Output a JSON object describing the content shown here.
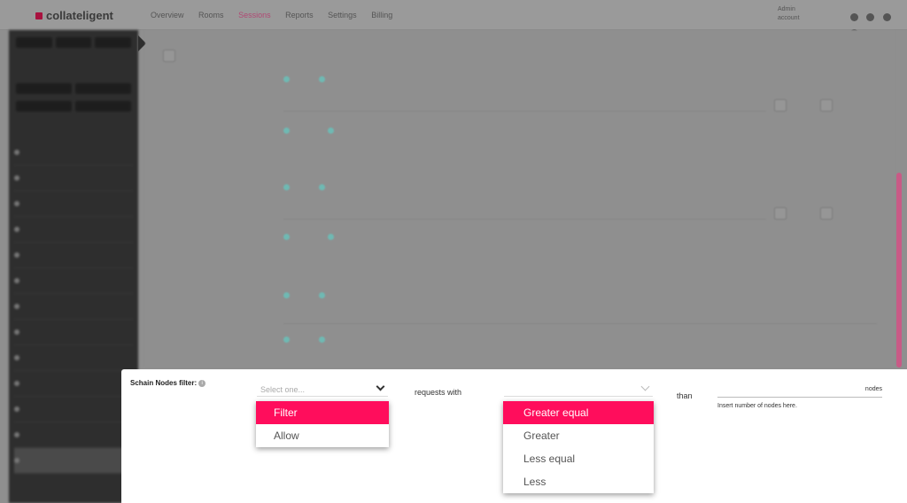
{
  "app": {
    "logo": "collateligent",
    "nav": [
      "Overview",
      "Rooms",
      "Sessions",
      "Reports",
      "Settings",
      "Billing"
    ],
    "active_nav_index": 2,
    "user_lines": [
      "Admin",
      "account"
    ]
  },
  "sidebar": {
    "tabs": [
      "",
      "",
      ""
    ],
    "items": [
      "",
      "",
      "",
      "",
      "",
      "",
      "",
      "",
      "",
      "",
      "",
      "",
      ""
    ]
  },
  "main_form": {
    "rows": []
  },
  "filter_panel": {
    "label": "Schain Nodes filter:",
    "select_action_placeholder": "Select one...",
    "action_options": [
      "Filter",
      "Allow"
    ],
    "action_selected_index": 0,
    "requests_with_text": "requests with",
    "comparison_options": [
      "Greater equal",
      "Greater",
      "Less equal",
      "Less"
    ],
    "comparison_selected_index": 0,
    "than_text": "than",
    "nodes_suffix": "nodes",
    "nodes_hint": "Insert number of nodes here."
  },
  "colors": {
    "accent": "#ff0d5c",
    "radio": "#6fb9b3",
    "sidebar_bg": "#2e2e2e"
  }
}
